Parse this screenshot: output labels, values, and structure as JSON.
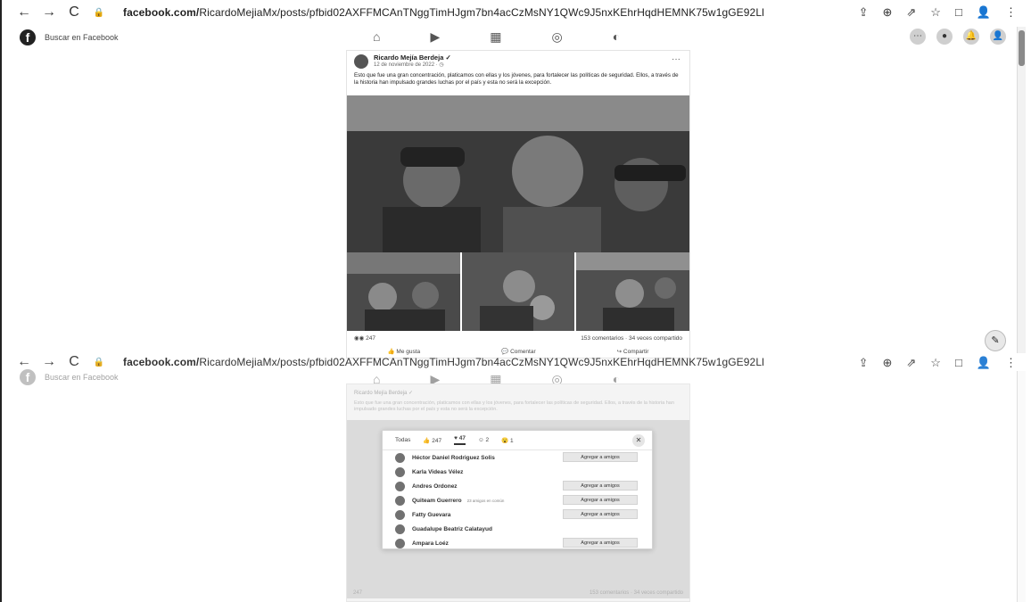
{
  "top": {
    "url_prefix": "facebook.com/",
    "url_rest": "RicardoMejiaMx/posts/pfbid02AXFFMCAnTNggTimHJgm7bn4acCzMsNY1QWc9J5nxKEhrHqdHEMNK75w1gGE92Ll",
    "nav": {
      "back": "←",
      "forward": "→",
      "reload": "C",
      "lock": "🔒"
    },
    "browser_icons": [
      "⇪",
      "⊕",
      "⇗",
      "☆",
      "□",
      "👤",
      "⋮"
    ],
    "fb_search_placeholder": "Buscar en Facebook",
    "fb_nav_icons": [
      "⌂",
      "▶",
      "▦",
      "◎",
      "◐"
    ],
    "fb_right_icons": [
      "⋯",
      "●",
      "🔔",
      "👤"
    ],
    "post": {
      "author": "Ricardo Mejía Berdeja ✓",
      "date": "12 de noviembre de 2022 · ◷",
      "text": "Esto que fue una gran concentración, platicamos con ellas y los jóvenes, para fortalecer las políticas de seguridad. Ellos, a través de la historia han impulsado grandes luchas por el país y esta no será la excepción.",
      "more": "···",
      "reactions_count": "247",
      "comments_shares": "153 comentarios · 34 veces compartido",
      "actions": [
        "Me gusta",
        "Comentar",
        "Compartir"
      ]
    },
    "edit_icon": "✎"
  },
  "bottom": {
    "url_prefix": "facebook.com/",
    "url_rest": "RicardoMejiaMx/posts/pfbid02AXFFMCAnTNggTimHJgm7bn4acCzMsNY1QWc9J5nxKEhrHqdHEMNK75w1gGE92Ll",
    "modal": {
      "tabs": [
        "Todas",
        "247",
        "47",
        "2",
        "1"
      ],
      "close": "✕",
      "people": [
        {
          "name": "Héctor Daniel Rodriguez Solis",
          "sub": "",
          "button": "Agregar a amigos"
        },
        {
          "name": "Karla Videas Vélez",
          "sub": "",
          "button": ""
        },
        {
          "name": "Andres Ordonez",
          "sub": "",
          "button": "Agregar a amigos"
        },
        {
          "name": "Quiteam Guerrero",
          "sub": "23 amigos en común",
          "button": "Agregar a amigos"
        },
        {
          "name": "Fatty Guevara",
          "sub": "",
          "button": "Agregar a amigos"
        },
        {
          "name": "Guadalupe Beatriz Calatayud",
          "sub": "",
          "button": ""
        },
        {
          "name": "Ampara Loéz",
          "sub": "",
          "button": "Agregar a amigos"
        }
      ]
    },
    "footer_left": "247",
    "footer_right": "153 comentarios · 34 veces compartido"
  },
  "colors": {
    "accent": "#1c1c1c",
    "page_bg": "#ffffff"
  }
}
